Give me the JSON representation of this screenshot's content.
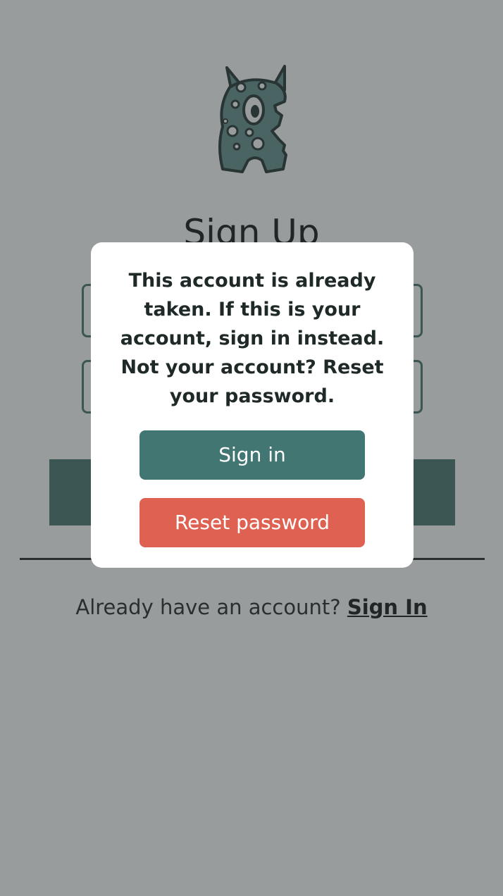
{
  "page": {
    "title": "Sign Up",
    "signin_prompt": "Already have an account?",
    "signin_link": "Sign In"
  },
  "logo": {
    "icon": "monster-mascot-icon",
    "colors": {
      "body": "#5f8e8c",
      "outline": "#1f2f2e",
      "spots": "#ffffff"
    }
  },
  "dialog": {
    "message": "This account is already taken. If this is your account, sign in instead. Not your account? Reset your password.",
    "primary_button": "Sign in",
    "secondary_button": "Reset password"
  },
  "colors": {
    "accent": "#44726f",
    "primary_button": "#427673",
    "danger_button": "#df6152",
    "overlay": "rgba(52,58,58,0.5)"
  }
}
